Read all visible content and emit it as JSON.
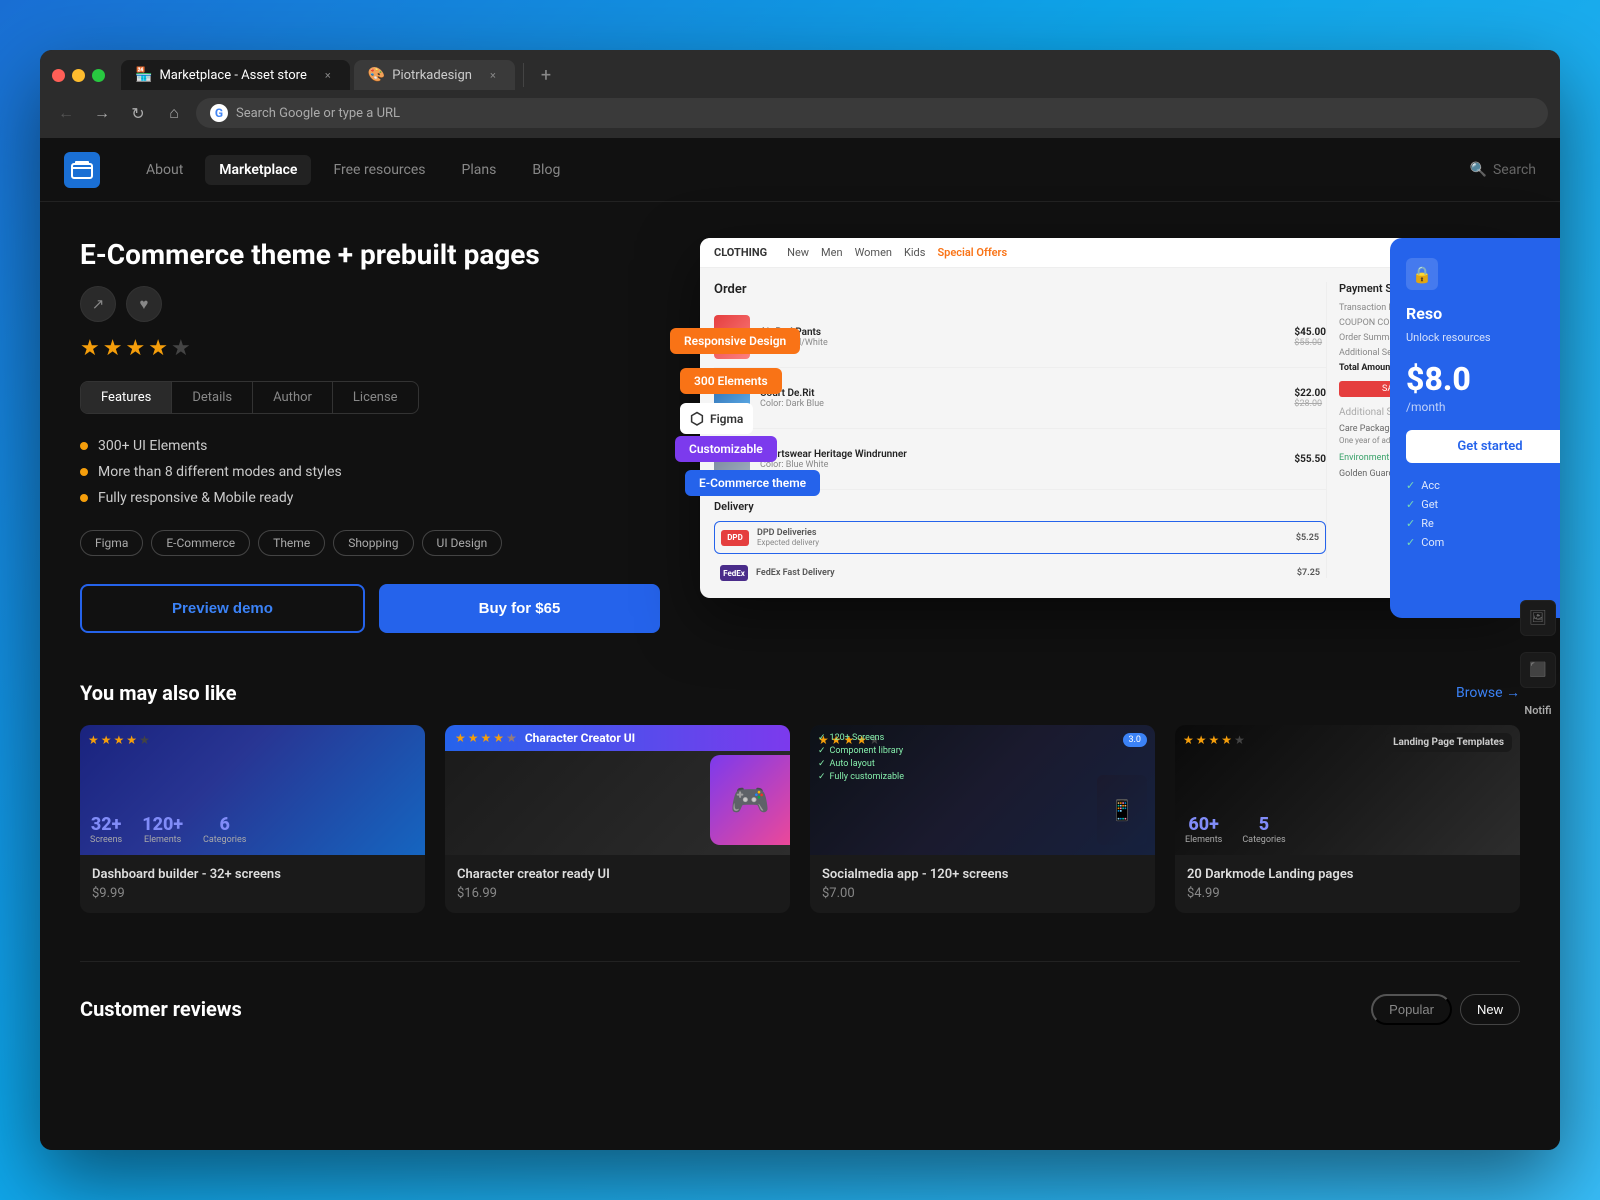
{
  "browser": {
    "tabs": [
      {
        "id": "tab1",
        "label": "Marketplace - Asset store",
        "icon": "🏪",
        "active": true
      },
      {
        "id": "tab2",
        "label": "Piotrkadesign",
        "icon": "🎨",
        "active": false
      }
    ],
    "address": "Search Google or type a URL"
  },
  "nav": {
    "logo_alt": "Logo",
    "links": [
      {
        "id": "about",
        "label": "About",
        "active": false
      },
      {
        "id": "marketplace",
        "label": "Marketplace",
        "active": true
      },
      {
        "id": "free-resources",
        "label": "Free resources",
        "active": false
      },
      {
        "id": "plans",
        "label": "Plans",
        "active": false
      },
      {
        "id": "blog",
        "label": "Blog",
        "active": false
      }
    ],
    "search_label": "Search"
  },
  "product": {
    "title": "E-Commerce theme + prebuilt pages",
    "rating": 4,
    "max_rating": 5,
    "tabs": [
      {
        "id": "features",
        "label": "Features",
        "active": true
      },
      {
        "id": "details",
        "label": "Details",
        "active": false
      },
      {
        "id": "author",
        "label": "Author",
        "active": false
      },
      {
        "id": "license",
        "label": "License",
        "active": false
      }
    ],
    "features": [
      "300+ UI Elements",
      "More than 8 different modes and styles",
      "Fully responsive & Mobile ready"
    ],
    "tags": [
      "Figma",
      "E-Commerce",
      "Theme",
      "Shopping",
      "UI Design"
    ],
    "preview_label": "Preview demo",
    "buy_label": "Buy for $65",
    "floating_labels": [
      {
        "id": "responsive",
        "text": "Responsive Design",
        "color": "orange"
      },
      {
        "id": "elements",
        "text": "300 Elements",
        "color": "orange"
      },
      {
        "id": "figma",
        "text": "Figma",
        "color": "white"
      },
      {
        "id": "customizable",
        "text": "Customizable",
        "color": "purple"
      },
      {
        "id": "commerce",
        "text": "E-Commerce theme",
        "color": "blue"
      }
    ]
  },
  "promo_panel": {
    "title": "Reso",
    "description": "Unlock resources",
    "price": "$8.0",
    "period": "/month",
    "features": [
      "Acc",
      "Get",
      "Re",
      "Com"
    ]
  },
  "recommendations": {
    "title": "You may also like",
    "browse_label": "Browse →",
    "cards": [
      {
        "id": "card1",
        "name": "Dashboard builder - 32+ screens",
        "price": "$9.99",
        "rating": 4,
        "stats": [
          {
            "num": "32+",
            "label": "Screens"
          },
          {
            "num": "120+",
            "label": "Elements"
          },
          {
            "num": "6",
            "label": "Categories"
          }
        ]
      },
      {
        "id": "card2",
        "name": "Character creator ready UI",
        "price": "$16.99",
        "rating": 4.5,
        "header_label": "Character Creator UI"
      },
      {
        "id": "card3",
        "name": "Socialmedia app - 120+ screens",
        "price": "$7.00",
        "rating": 4,
        "badge": "3.0",
        "features_list": [
          "120+ Screens",
          "Component library",
          "Auto layout",
          "Fully customizable"
        ]
      },
      {
        "id": "card4",
        "name": "20 Darkmode Landing pages",
        "price": "$4.99",
        "rating": 4,
        "header_label": "Landing Page Templates",
        "stats": [
          {
            "num": "60+",
            "label": "Elements"
          },
          {
            "num": "5",
            "label": "Categories"
          }
        ]
      }
    ]
  },
  "reviews": {
    "title": "Customer reviews",
    "sort_options": [
      {
        "id": "popular",
        "label": "Popular",
        "active": false
      },
      {
        "id": "new",
        "label": "New",
        "active": true
      }
    ]
  }
}
